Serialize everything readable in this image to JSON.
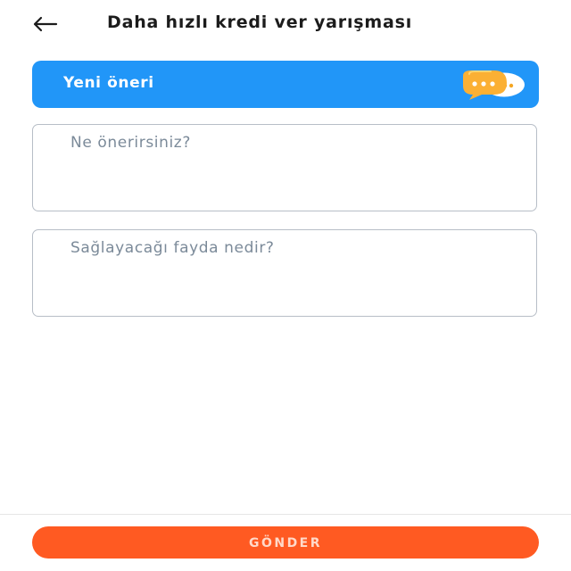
{
  "header": {
    "back_icon": "arrow-left-icon",
    "title": "Daha hızlı kredi ver yarışması"
  },
  "banner": {
    "title": "Yeni öneri",
    "icon": "chat-bubbles-icon",
    "background_color": "#2196f8"
  },
  "form": {
    "suggestion_placeholder": "Ne önerirsiniz?",
    "benefit_placeholder": "Sağlayacağı fayda nedir?"
  },
  "footer": {
    "submit_label": "GÖNDER",
    "submit_color": "#ff5a22"
  }
}
